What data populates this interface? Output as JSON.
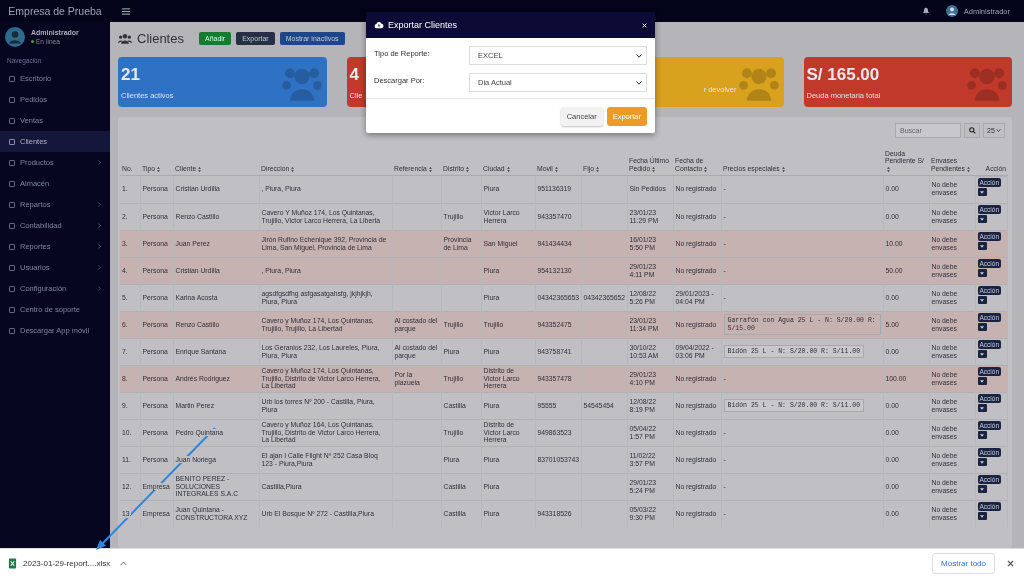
{
  "header": {
    "brand": "Empresa de Prueba",
    "user": "Administrador"
  },
  "sidebar": {
    "user": {
      "name": "Administrador",
      "status": "En línea"
    },
    "section_label": "Navegación",
    "items": [
      {
        "label": "Escritorio",
        "selected": false,
        "has_submenu": false
      },
      {
        "label": "Pedidos",
        "selected": false,
        "has_submenu": false
      },
      {
        "label": "Ventas",
        "selected": false,
        "has_submenu": false
      },
      {
        "label": "Clientes",
        "selected": true,
        "has_submenu": false
      },
      {
        "label": "Productos",
        "selected": false,
        "has_submenu": true
      },
      {
        "label": "Almacén",
        "selected": false,
        "has_submenu": false
      },
      {
        "label": "Repartos",
        "selected": false,
        "has_submenu": true
      },
      {
        "label": "Contabilidad",
        "selected": false,
        "has_submenu": true
      },
      {
        "label": "Reportes",
        "selected": false,
        "has_submenu": true
      },
      {
        "label": "Usuarios",
        "selected": false,
        "has_submenu": true
      },
      {
        "label": "Configuración",
        "selected": false,
        "has_submenu": true
      },
      {
        "label": "Centro de soporte",
        "selected": false,
        "has_submenu": false
      },
      {
        "label": "Descargar App móvil",
        "selected": false,
        "has_submenu": false
      }
    ]
  },
  "page": {
    "title": "Clientes",
    "buttons": [
      {
        "label": "Añadir",
        "kind": "add"
      },
      {
        "label": "Exportar",
        "kind": "export"
      },
      {
        "label": "Mostrar inactivos",
        "kind": "inactive"
      }
    ]
  },
  "cards": [
    {
      "value": "21",
      "label": "Clientes activos",
      "color": "#2f72c4"
    },
    {
      "value": "4",
      "label": "Clie",
      "color": "#c0392b"
    },
    {
      "label": "r devolver",
      "color": "#d9a21e"
    },
    {
      "value": "S/ 165.00",
      "label": "Deuda monetaria total",
      "color": "#c0392b"
    }
  ],
  "table": {
    "search_placeholder": "Buscar",
    "page_size": "25",
    "columns": [
      {
        "label": "No.",
        "sortable": false
      },
      {
        "label": "Tipo",
        "sortable": true
      },
      {
        "label": "Cliente",
        "sortable": true
      },
      {
        "label": "Direccion",
        "sortable": true
      },
      {
        "label": "Referencia",
        "sortable": true
      },
      {
        "label": "Distrito",
        "sortable": true
      },
      {
        "label": "Ciudad",
        "sortable": true
      },
      {
        "label": "Movil",
        "sortable": true
      },
      {
        "label": "Fijo",
        "sortable": true
      },
      {
        "label": "Fecha Último Pedido",
        "sortable": true
      },
      {
        "label": "Fecha de Contacto",
        "sortable": true
      },
      {
        "label": "Precios especiales",
        "sortable": true
      },
      {
        "label": "Deuda Pendiente S/",
        "sortable": true
      },
      {
        "label": "Envases Pendientes",
        "sortable": true
      },
      {
        "label": "Acción",
        "sortable": false
      }
    ],
    "rows": [
      {
        "highlighted": false,
        "price_boxed": false,
        "action": "Acción",
        "cells": [
          "1.",
          "Persona",
          "Cristian Urdilla",
          ", Piura, Piura",
          "",
          "",
          "Piura",
          "951136319",
          "",
          "Sin Pedidos",
          "No registrado",
          "-",
          "0.00",
          "No debe envases"
        ]
      },
      {
        "highlighted": false,
        "price_boxed": false,
        "action": "Acción",
        "cells": [
          "2.",
          "Persona",
          "Renzo Castillo",
          "Cavero Y Muñoz 174, Los Quintanas, Trujillo, Victor Larco Herrera, La Liberta",
          "",
          "Trujillo",
          "Victor Larco Herrera",
          "943357470",
          "",
          "23/01/23 11:29 PM",
          "No registrado",
          "-",
          "0.00",
          "No debe envases"
        ]
      },
      {
        "highlighted": true,
        "price_boxed": false,
        "action": "Acción",
        "cells": [
          "3.",
          "Persona",
          "Juan Perez",
          "Jirón Rufino Echenique 392, Provincia de Lima, San Miguel, Provincia de Lima",
          "",
          "Provincia de Lima",
          "San Miguel",
          "941434434",
          "",
          "16/01/23 5:50 PM",
          "No registrado",
          "-",
          "10.00",
          "No debe envases"
        ]
      },
      {
        "highlighted": true,
        "price_boxed": false,
        "action": "Acción",
        "cells": [
          "4.",
          "Persona",
          "Cristian Urdilla",
          ", Piura, Piura",
          "",
          "",
          "Piura",
          "954132130",
          "",
          "29/01/23 4:11 PM",
          "No registrado",
          "-",
          "50.00",
          "No debe envases"
        ]
      },
      {
        "highlighted": false,
        "price_boxed": false,
        "action": "Acción",
        "cells": [
          "5.",
          "Persona",
          "Karina Acosta",
          "agsdfgsdfhg asfgasatgahsfg, jkjhjkjh, Piura, Piura",
          "",
          "",
          "Piura",
          "04342365653",
          "04342365652",
          "12/08/22 5:26 PM",
          "29/01/2023 - 04:04 PM",
          "-",
          "0.00",
          "No debe envases"
        ]
      },
      {
        "highlighted": true,
        "price_boxed": true,
        "action": "Acción",
        "cells": [
          "6.",
          "Persona",
          "Renzo Castillo",
          "Cavero y Muñoz 174, Los Quintanas, Trujillo, Trujillo, La Libertad",
          "Al costado del parque",
          "Trujillo",
          "Trujillo",
          "943352475",
          "",
          "23/01/23 11:34 PM",
          "No registrado",
          "Garrafón con Agua 25 L -  N: S/20.00 R: S/15.00",
          "5.00",
          "No debe envases"
        ]
      },
      {
        "highlighted": false,
        "price_boxed": true,
        "action": "Acción",
        "cells": [
          "7.",
          "Persona",
          "Enrique Santana",
          "Los Geranios 232, Los Laureles, Piura, Piura, Piura",
          "Al costado del parque",
          "Piura",
          "Piura",
          "943758741",
          "",
          "30/10/22 10:53 AM",
          "09/04/2022 - 03:06 PM",
          "Bidón 25 L -  N: S/20.00 R: S/11.00",
          "0.00",
          "No debe envases"
        ]
      },
      {
        "highlighted": true,
        "price_boxed": false,
        "action": "Acción",
        "cells": [
          "8.",
          "Persona",
          "Andrés Rodriguez",
          "Cavero y Muñoz 174, Los Quintanas, Trujillo, Distrito de Victor Larco Herrera, La Libertad",
          "Por la plazuela",
          "Trujillo",
          "Distrito de Victor Larco Herrera",
          "943357478",
          "",
          "29/01/23 4:10 PM",
          "No registrado",
          "-",
          "100.00",
          "No debe envases"
        ]
      },
      {
        "highlighted": false,
        "price_boxed": true,
        "action": "Acción",
        "cells": [
          "9.",
          "Persona",
          "Martin Perez",
          "Urb los torres Nº 200 - Castilla, Piura, Piura",
          "",
          "Castilla",
          "Piura",
          "95555",
          "54545454",
          "12/08/22 8:19 PM",
          "No registrado",
          "Bidón 25 L -  N: S/20.00 R: S/11.00",
          "0.00",
          "No debe envases"
        ]
      },
      {
        "highlighted": false,
        "price_boxed": false,
        "action": "Acción",
        "cells": [
          "10.",
          "Persona",
          "Pedro Quintana",
          "Cavero y Muñoz 164, Los Quintanas, Trujillo, Distrito de Victor Larco Herrera, La Libertad",
          "",
          "Trujillo",
          "Distrito de Victor Larco Herrera",
          "949863523",
          "",
          "05/04/22 1:57 PM",
          "No registrado",
          "-",
          "0.00",
          "No debe envases"
        ]
      },
      {
        "highlighted": false,
        "price_boxed": false,
        "action": "Acción",
        "cells": [
          "11.",
          "Persona",
          "Juan Noriega",
          "El ajan I Calle Flight Nº 252 Casa Bloq 123 - Piura,Piura",
          "",
          "Piura",
          "Piura",
          "83701053743",
          "",
          "11/02/22 3:57 PM",
          "No registrado",
          "-",
          "0.00",
          "No debe envases"
        ]
      },
      {
        "highlighted": false,
        "price_boxed": false,
        "action": "Acción",
        "cells": [
          "12.",
          "Empresa",
          "BENITO PEREZ - SOLUCIONES INTEGRALES S.A.C",
          "Castilla,Piura",
          "",
          "Castilla",
          "Piura",
          "",
          "",
          "29/01/23 5:24 PM",
          "No registrado",
          "-",
          "0.00",
          "No debe envases"
        ]
      },
      {
        "highlighted": false,
        "price_boxed": false,
        "action": "Acción",
        "cells": [
          "13.",
          "Empresa",
          "Juan Quintana - CONSTRUCTORA XYZ",
          "Urb El Bosque Nº 272 - Castilla,Piura",
          "",
          "Castilla",
          "Piura",
          "943318526",
          "",
          "05/03/22 9:30 PM",
          "No registrado",
          "-",
          "0.00",
          "No debe envases"
        ]
      }
    ]
  },
  "modal": {
    "title": "Exportar Clientes",
    "fields": [
      {
        "label": "Tipo de Reporte:",
        "value": "EXCEL"
      },
      {
        "label": "Descargar Por:",
        "value": "Dia Actual"
      }
    ],
    "buttons": [
      {
        "label": "Cancelar",
        "kind": "cancel"
      },
      {
        "label": "Exportar",
        "kind": "primary"
      }
    ]
  },
  "download_bar": {
    "file": "2023-01-29-report....xlsx",
    "show_all": "Mostrar todo"
  }
}
